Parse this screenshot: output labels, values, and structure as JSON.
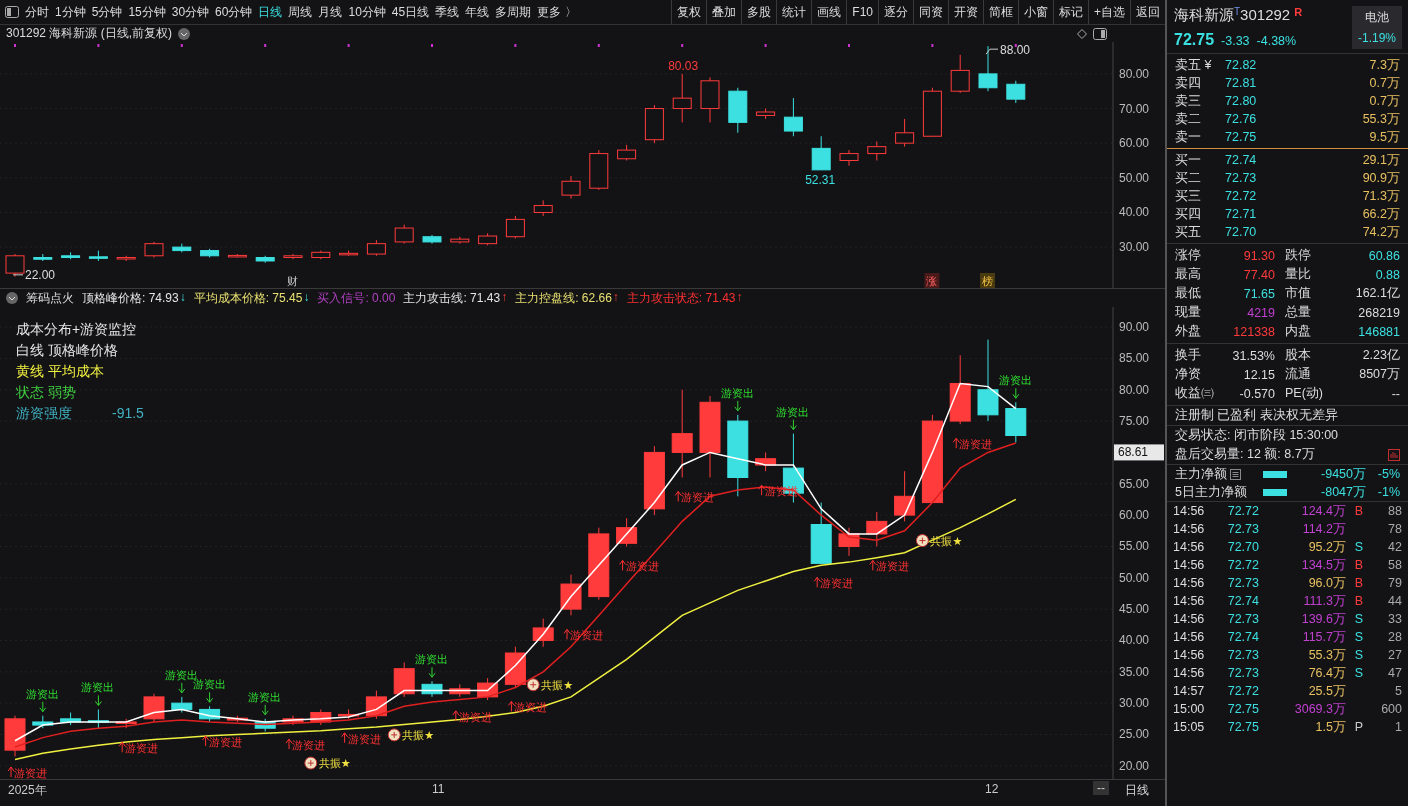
{
  "toolbar": {
    "periods": [
      {
        "label": "分时",
        "selected": false
      },
      {
        "label": "1分钟",
        "selected": false
      },
      {
        "label": "5分钟",
        "selected": false
      },
      {
        "label": "15分钟",
        "selected": false
      },
      {
        "label": "30分钟",
        "selected": false
      },
      {
        "label": "60分钟",
        "selected": false
      },
      {
        "label": "日线",
        "selected": true
      },
      {
        "label": "周线",
        "selected": false
      },
      {
        "label": "月线",
        "selected": false
      },
      {
        "label": "10分钟",
        "selected": false
      },
      {
        "label": "45日线",
        "selected": false
      },
      {
        "label": "季线",
        "selected": false
      },
      {
        "label": "年线",
        "selected": false
      },
      {
        "label": "多周期",
        "selected": false
      },
      {
        "label": "更多 〉",
        "selected": false
      }
    ],
    "buttons": [
      "复权",
      "叠加",
      "多股",
      "统计",
      "画线",
      "F10",
      "逐分",
      "同资",
      "开资",
      "简框",
      "小窗",
      "标记",
      "+自选",
      "返回"
    ]
  },
  "chart_title": "301292 海科新源 (日线,前复权)",
  "price_chart": {
    "axis": [
      "80.00",
      "70.00",
      "60.00",
      "50.00",
      "40.00",
      "30.00"
    ],
    "labels": [
      {
        "text": "80.03",
        "kind": "high"
      },
      {
        "text": "52.31",
        "kind": "low"
      },
      {
        "text": "88.00",
        "kind": "peak"
      },
      {
        "text": "22.00",
        "kind": "start"
      }
    ],
    "events": [
      {
        "text": "财",
        "kind": "plain"
      },
      {
        "text": "涨",
        "kind": "hot"
      },
      {
        "text": "榜",
        "kind": "list"
      }
    ]
  },
  "indicator": {
    "name": "筹码点火",
    "values": [
      {
        "label": "顶格峰价格: 74.93",
        "arrow": "↓",
        "rising": false,
        "color": "#e6e6e6"
      },
      {
        "label": "平均成本价格: 75.45",
        "arrow": "↓",
        "rising": false,
        "color": "#e8e070"
      },
      {
        "label": "买入信号: 0.00",
        "color": "#b040c0"
      },
      {
        "label": "主力攻击线: 71.43",
        "arrow": "↑",
        "rising": true,
        "color": "#e6e6e6"
      },
      {
        "label": "主力控盘线: 62.66",
        "arrow": "↑",
        "rising": true,
        "color": "#e8e070"
      },
      {
        "label": "主力攻击状态: 71.43",
        "arrow": "↑",
        "rising": true,
        "color": "#ff3030"
      }
    ],
    "legend": [
      {
        "text": "成本分布+游资监控",
        "color": "#e6e6e6"
      },
      {
        "text": "白线 顶格峰价格",
        "color": "#e6e6e6"
      },
      {
        "text": "黄线 平均成本",
        "color": "#f0f040"
      },
      {
        "text": "状态 弱势",
        "color": "#40d040"
      },
      {
        "text": "游资强度",
        "value": "-91.5",
        "color": "#40b0c0"
      }
    ],
    "axis": [
      "90.00",
      "85.00",
      "80.00",
      "75.00",
      "65.00",
      "60.00",
      "55.00",
      "50.00",
      "45.00",
      "40.00",
      "35.00",
      "30.00",
      "25.00",
      "20.00"
    ],
    "current": "68.61",
    "markers": [
      {
        "text": "游资出",
        "kind": "out"
      },
      {
        "text": "游资出",
        "kind": "out"
      },
      {
        "text": "游资出",
        "kind": "out"
      },
      {
        "text": "游资出",
        "kind": "out"
      },
      {
        "text": "游资出",
        "kind": "out"
      },
      {
        "text": "游资出",
        "kind": "out"
      },
      {
        "text": "游资出",
        "kind": "out"
      },
      {
        "text": "游资出",
        "kind": "out"
      },
      {
        "text": "游资出",
        "kind": "out"
      },
      {
        "text": "游资进",
        "kind": "in"
      },
      {
        "text": "游资进",
        "kind": "in"
      },
      {
        "text": "游资进",
        "kind": "in"
      },
      {
        "text": "游资进",
        "kind": "in"
      },
      {
        "text": "游资进",
        "kind": "in"
      },
      {
        "text": "游资进",
        "kind": "in"
      },
      {
        "text": "游资进",
        "kind": "in"
      },
      {
        "text": "游资进",
        "kind": "in"
      },
      {
        "text": "游资进",
        "kind": "in"
      },
      {
        "text": "游资进",
        "kind": "in"
      },
      {
        "text": "游资进",
        "kind": "in"
      },
      {
        "text": "游资进",
        "kind": "in"
      },
      {
        "text": "游资进",
        "kind": "in"
      },
      {
        "text": "游资进",
        "kind": "in"
      },
      {
        "text": "共振★",
        "kind": "resonance"
      },
      {
        "text": "共振★",
        "kind": "resonance"
      },
      {
        "text": "共振★",
        "kind": "resonance"
      },
      {
        "text": "共振★",
        "kind": "resonance"
      }
    ]
  },
  "time_axis": {
    "labels": [
      "2025年",
      "11",
      "12"
    ],
    "corner": "--",
    "period": "日线"
  },
  "quote": {
    "name": "海科新源",
    "board": "T",
    "code": "301292",
    "flag": "R",
    "price": "72.75",
    "change": "-3.33",
    "change_pct": "-4.38%",
    "sector": "电池",
    "sector_pct": "-1.19%"
  },
  "asks": [
    {
      "label": "卖五 ¥",
      "price": "72.82",
      "volume": "7.3万"
    },
    {
      "label": "卖四",
      "price": "72.81",
      "volume": "0.7万"
    },
    {
      "label": "卖三",
      "price": "72.80",
      "volume": "0.7万"
    },
    {
      "label": "卖二",
      "price": "72.76",
      "volume": "55.3万"
    },
    {
      "label": "卖一",
      "price": "72.75",
      "volume": "9.5万"
    }
  ],
  "bids": [
    {
      "label": "买一",
      "price": "72.74",
      "volume": "29.1万"
    },
    {
      "label": "买二",
      "price": "72.73",
      "volume": "90.9万"
    },
    {
      "label": "买三",
      "price": "72.72",
      "volume": "71.3万"
    },
    {
      "label": "买四",
      "price": "72.71",
      "volume": "66.2万"
    },
    {
      "label": "买五",
      "price": "72.70",
      "volume": "74.2万"
    }
  ],
  "stats": [
    [
      {
        "label": "涨停",
        "value": "91.30",
        "color": "#ff3b3b"
      },
      {
        "label": "跌停",
        "value": "60.86",
        "color": "#3ce0e0"
      }
    ],
    [
      {
        "label": "最高",
        "value": "77.40",
        "color": "#ff3b3b"
      },
      {
        "label": "量比",
        "value": "0.88",
        "color": "#3ce0e0"
      }
    ],
    [
      {
        "label": "最低",
        "value": "71.65",
        "color": "#3ce0e0"
      },
      {
        "label": "市值",
        "value": "162.1亿",
        "color": "#dddddd"
      }
    ],
    [
      {
        "label": "现量",
        "value": "4219",
        "color": "#c040d0"
      },
      {
        "label": "总量",
        "value": "268219",
        "color": "#dddddd"
      }
    ],
    [
      {
        "label": "外盘",
        "value": "121338",
        "color": "#ff3b3b"
      },
      {
        "label": "内盘",
        "value": "146881",
        "color": "#3ce0e0"
      }
    ]
  ],
  "fundamentals": [
    [
      {
        "label": "换手",
        "value": "31.53%"
      },
      {
        "label": "股本",
        "value": "2.23亿"
      }
    ],
    [
      {
        "label": "净资",
        "value": "12.15"
      },
      {
        "label": "流通",
        "value": "8507万"
      }
    ],
    [
      {
        "label": "收益㈢",
        "value": "-0.570"
      },
      {
        "label": "PE(动)",
        "value": "--"
      }
    ]
  ],
  "tags": "注册制 已盈利 表决权无差异",
  "trade_status": "交易状态: 闭市阶段 15:30:00",
  "after_hours": "盘后交易量: 12  额: 8.7万",
  "fund_flow": [
    {
      "label": "主力净额",
      "amount": "-9450万",
      "pct": "-5%",
      "note_icon": true
    },
    {
      "label": "5日主力净额",
      "amount": "-8047万",
      "pct": "-1%",
      "note_icon": false
    }
  ],
  "trades": [
    {
      "time": "14:56",
      "price": "72.72",
      "amount": "124.4万",
      "large": true,
      "side": "B",
      "color": "#ff3b3b",
      "count": "88"
    },
    {
      "time": "14:56",
      "price": "72.73",
      "amount": "114.2万",
      "large": true,
      "count": "78"
    },
    {
      "time": "14:56",
      "price": "72.70",
      "amount": "95.2万",
      "large": false,
      "side": "S",
      "color": "#3ce0e0",
      "count": "42"
    },
    {
      "time": "14:56",
      "price": "72.72",
      "amount": "134.5万",
      "large": true,
      "side": "B",
      "color": "#ff3b3b",
      "count": "58"
    },
    {
      "time": "14:56",
      "price": "72.73",
      "amount": "96.0万",
      "large": false,
      "side": "B",
      "color": "#ff3b3b",
      "count": "79"
    },
    {
      "time": "14:56",
      "price": "72.74",
      "amount": "111.3万",
      "large": true,
      "side": "B",
      "color": "#ff3b3b",
      "count": "44"
    },
    {
      "time": "14:56",
      "price": "72.73",
      "amount": "139.6万",
      "large": true,
      "side": "S",
      "color": "#3ce0e0",
      "count": "33"
    },
    {
      "time": "14:56",
      "price": "72.74",
      "amount": "115.7万",
      "large": true,
      "side": "S",
      "color": "#3ce0e0",
      "count": "28"
    },
    {
      "time": "14:56",
      "price": "72.73",
      "amount": "55.3万",
      "large": false,
      "side": "S",
      "color": "#3ce0e0",
      "count": "27"
    },
    {
      "time": "14:56",
      "price": "72.73",
      "amount": "76.4万",
      "large": false,
      "side": "S",
      "color": "#3ce0e0",
      "count": "47"
    },
    {
      "time": "14:57",
      "price": "72.72",
      "amount": "25.5万",
      "large": false,
      "count": "5"
    },
    {
      "time": "15:00",
      "price": "72.75",
      "amount": "3069.3万",
      "large": true,
      "count": "600"
    },
    {
      "time": "15:05",
      "price": "72.75",
      "amount": "1.5万",
      "large": false,
      "side": "P",
      "color": "#cccccc",
      "count": "1"
    }
  ]
}
